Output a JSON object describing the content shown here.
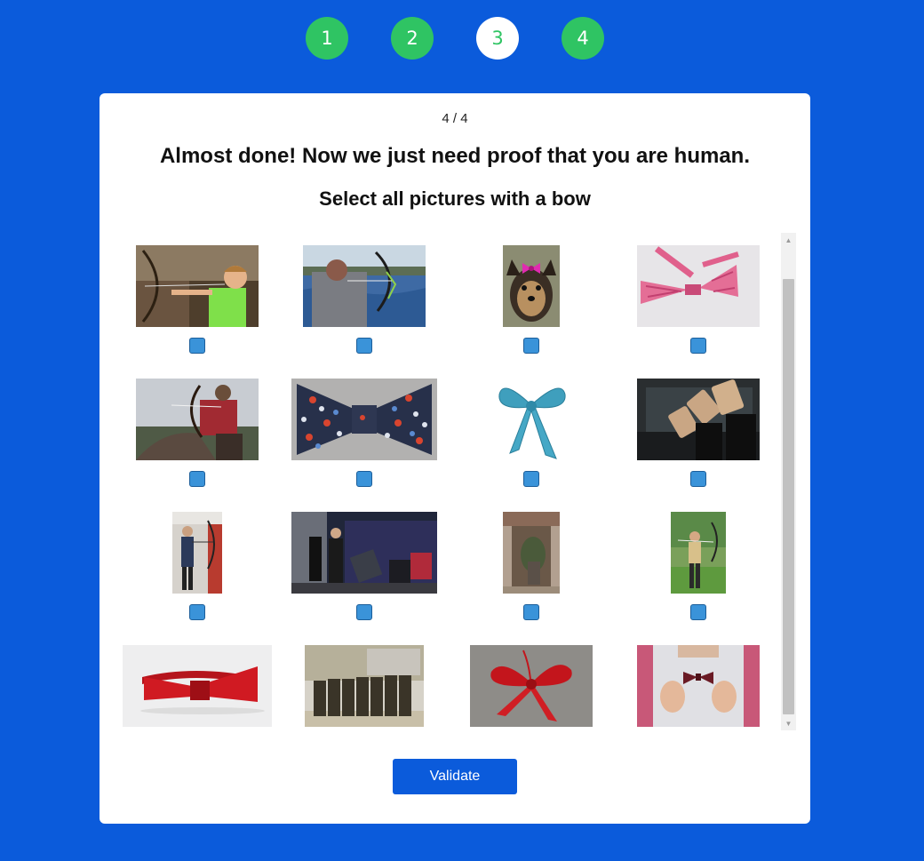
{
  "steps": [
    "1",
    "2",
    "3",
    "4"
  ],
  "active_step": "3",
  "card": {
    "counter": "4 / 4",
    "heading": "Almost done! Now we just need proof that you are human.",
    "instruction": "Select all pictures with a bow"
  },
  "images": [
    {
      "name": "archery-boy-image"
    },
    {
      "name": "archer-lake-image"
    },
    {
      "name": "dog-hair-bow-image"
    },
    {
      "name": "pink-plaid-bowtie-image"
    },
    {
      "name": "horseback-archer-image"
    },
    {
      "name": "floral-bowtie-image"
    },
    {
      "name": "teal-ribbon-bow-image"
    },
    {
      "name": "people-bowing-boxes-image"
    },
    {
      "name": "indoor-archer-image"
    },
    {
      "name": "business-bowing-image"
    },
    {
      "name": "garden-doorway-image"
    },
    {
      "name": "outdoor-archer-image"
    },
    {
      "name": "red-bowtie-image"
    },
    {
      "name": "group-bowing-image"
    },
    {
      "name": "red-ribbon-bow-image"
    },
    {
      "name": "man-bowtie-image"
    }
  ],
  "validate_label": "Validate"
}
